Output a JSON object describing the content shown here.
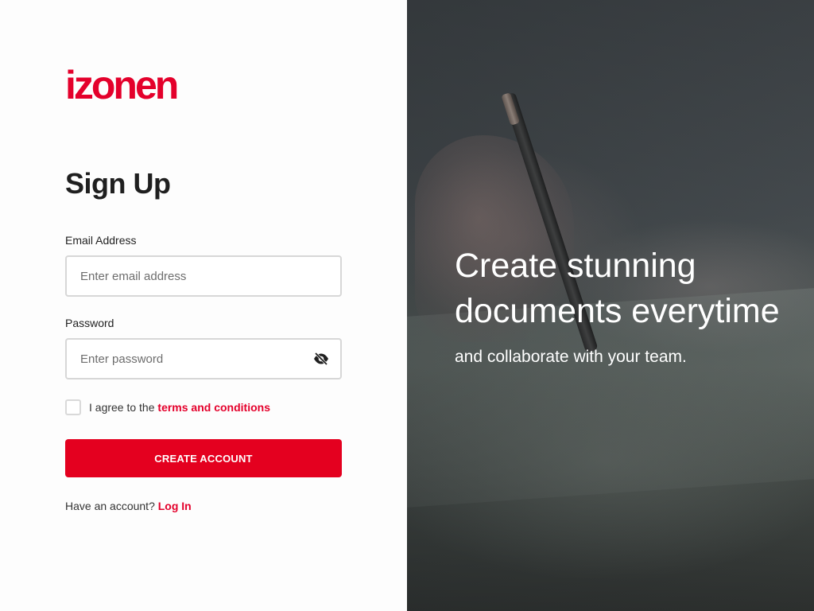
{
  "brand": {
    "logo_text": "izonen",
    "accent_color": "#e4002b"
  },
  "form": {
    "title": "Sign Up",
    "email": {
      "label": "Email Address",
      "placeholder": "Enter email address",
      "value": ""
    },
    "password": {
      "label": "Password",
      "placeholder": "Enter password",
      "value": "",
      "toggle_icon": "eye-slash-icon"
    },
    "agree": {
      "prefix": "I agree to the",
      "link": "terms and conditions",
      "checked": false
    },
    "submit_label": "CREATE ACCOUNT",
    "login_prompt": "Have an account?",
    "login_link": "Log In"
  },
  "hero": {
    "line1": "Create stunning",
    "line2": "documents everytime",
    "subtitle": "and collaborate with your team."
  }
}
